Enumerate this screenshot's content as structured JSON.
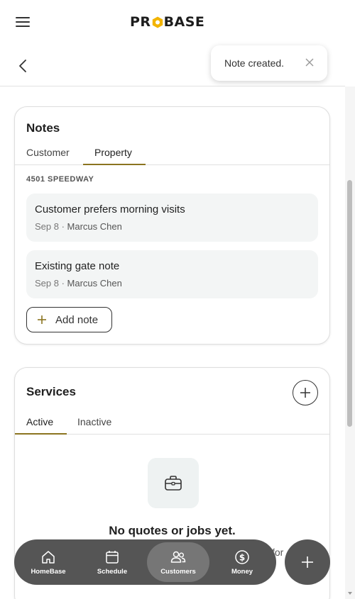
{
  "header": {
    "logo_left": "PR",
    "logo_right": "BASE"
  },
  "toast": {
    "message": "Note created."
  },
  "notes": {
    "title": "Notes",
    "tabs": [
      {
        "label": "Customer",
        "active": false
      },
      {
        "label": "Property",
        "active": true
      }
    ],
    "property_label": "4501 SPEEDWAY",
    "items": [
      {
        "text": "Customer prefers morning visits",
        "date": "Sep 8",
        "author": "Marcus Chen"
      },
      {
        "text": "Existing gate note",
        "date": "Sep 8",
        "author": "Marcus Chen"
      }
    ],
    "add_label": "Add note"
  },
  "services": {
    "title": "Services",
    "tabs": [
      {
        "label": "Active",
        "active": true
      },
      {
        "label": "Inactive",
        "active": false
      }
    ],
    "empty_title": "No quotes or jobs yet.",
    "empty_sub_partial": "for"
  },
  "nav": {
    "items": [
      {
        "label": "HomeBase",
        "icon": "home-icon"
      },
      {
        "label": "Schedule",
        "icon": "calendar-icon"
      },
      {
        "label": "Customers",
        "icon": "users-icon",
        "active": true
      },
      {
        "label": "Money",
        "icon": "dollar-icon"
      }
    ]
  },
  "colors": {
    "accent": "#8b7420",
    "logo_hex": "#f2b400",
    "nav_bg": "#555555"
  }
}
